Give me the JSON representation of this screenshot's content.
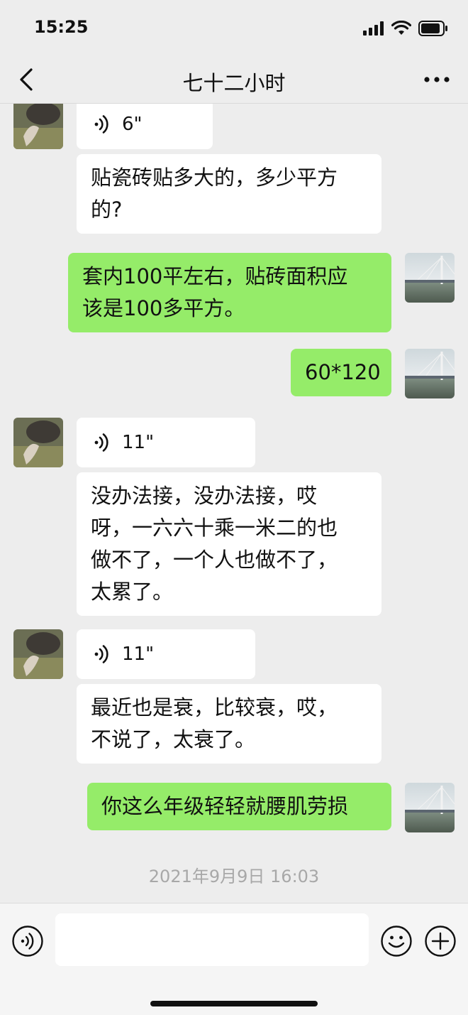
{
  "status_bar": {
    "time": "15:25"
  },
  "header": {
    "title": "七十二小时"
  },
  "messages": [
    {
      "type": "voice",
      "side": "in",
      "duration": "6\""
    },
    {
      "type": "text",
      "side": "in",
      "lines": [
        "贴瓷砖贴多大的，多少平方",
        "的?"
      ]
    },
    {
      "type": "text",
      "side": "out",
      "lines": [
        "套内100平左右，贴砖面积应",
        "该是100多平方。"
      ]
    },
    {
      "type": "text",
      "side": "out",
      "lines": [
        "60*120"
      ]
    },
    {
      "type": "voice",
      "side": "in",
      "duration": "11\""
    },
    {
      "type": "text",
      "side": "in",
      "lines": [
        "没办法接，没办法接，哎",
        "呀，一六六十乘一米二的也",
        "做不了，一个人也做不了，",
        "太累了。"
      ]
    },
    {
      "type": "voice",
      "side": "in",
      "duration": "11\""
    },
    {
      "type": "text",
      "side": "in",
      "lines": [
        "最近也是衰，比较衰，哎，",
        "不说了，太衰了。"
      ]
    },
    {
      "type": "text",
      "side": "out",
      "lines": [
        "你这么年级轻轻就腰肌劳损"
      ]
    }
  ],
  "timestamp": "2021年9月9日 16:03",
  "input": {
    "placeholder": ""
  },
  "icons": {
    "back": "chevron-left-icon",
    "more": "more-dots-icon",
    "voice": "voice-wave-icon",
    "emoji": "emoji-smile-icon",
    "plus": "plus-circle-icon"
  },
  "colors": {
    "outgoing_bubble": "#95ec69",
    "incoming_bubble": "#ffffff",
    "background": "#ededed"
  }
}
